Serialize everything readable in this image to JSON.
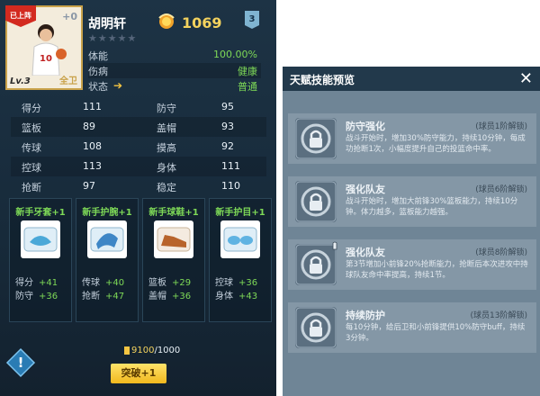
{
  "player": {
    "card_ribbon": "已上阵",
    "card_plus": "+0",
    "card_level": "Lv.3",
    "card_position": "全卫",
    "name": "胡明轩",
    "stars_filled": 0,
    "stars_total": 5
  },
  "header": {
    "coin_value": "1069",
    "badge_value": "3"
  },
  "status": [
    {
      "label": "体能",
      "value": "100.00%"
    },
    {
      "label": "伤病",
      "value": "健康"
    },
    {
      "label": "状态",
      "value": "普通"
    }
  ],
  "attributes": [
    {
      "k1": "得分",
      "v1": "111",
      "k2": "防守",
      "v2": "95"
    },
    {
      "k1": "篮板",
      "v1": "89",
      "k2": "盖帽",
      "v2": "93"
    },
    {
      "k1": "传球",
      "v1": "108",
      "k2": "摸高",
      "v2": "92"
    },
    {
      "k1": "控球",
      "v1": "113",
      "k2": "身体",
      "v2": "111"
    },
    {
      "k1": "抢断",
      "v1": "97",
      "k2": "稳定",
      "v2": "110"
    }
  ],
  "gear": [
    {
      "name": "新手牙套+1",
      "s1k": "得分",
      "s1v": "+41",
      "s2k": "防守",
      "s2v": "+36"
    },
    {
      "name": "新手护腕+1",
      "s1k": "传球",
      "s1v": "+40",
      "s2k": "抢断",
      "s2v": "+47"
    },
    {
      "name": "新手球鞋+1",
      "s1k": "篮板",
      "s1v": "+29",
      "s2k": "盖帽",
      "s2v": "+36"
    },
    {
      "name": "新手护目+1",
      "s1k": "控球",
      "s1v": "+36",
      "s2k": "身体",
      "s2v": "+43"
    }
  ],
  "breakthrough": {
    "progress_current": "9100",
    "progress_total": "/1000",
    "button_label": "突破+1"
  },
  "talent_panel": {
    "title": "天赋技能预览",
    "close_label": "✕",
    "skills": [
      {
        "name": "防守强化",
        "lock": "(球员1阶解锁)",
        "desc": "战斗开始时，增加30%防守能力，持续10分钟，每成功抢断1次，小幅度提升自己的投篮命中率。"
      },
      {
        "name": "强化队友",
        "lock": "(球员6阶解锁)",
        "desc": "战斗开始时，增加大前锋30%篮板能力，持续10分钟。体力越多，篮板能力越强。"
      },
      {
        "name": "强化队友",
        "lock": "(球员8阶解锁)",
        "desc": "第3节增加小前锋20%抢断能力，抢断后本次进攻中持球队友命中率提高，持续1节。"
      },
      {
        "name": "持续防护",
        "lock": "(球员13阶解锁)",
        "desc": "每10分钟，给后卫和小前锋提供10%防守buff，持续3分钟。"
      }
    ]
  },
  "colors": {
    "accent_green": "#7ed957",
    "coin_gold": "#f4d35e",
    "ribbon_red": "#d32a1f",
    "panel_dark": "#1d3345"
  }
}
